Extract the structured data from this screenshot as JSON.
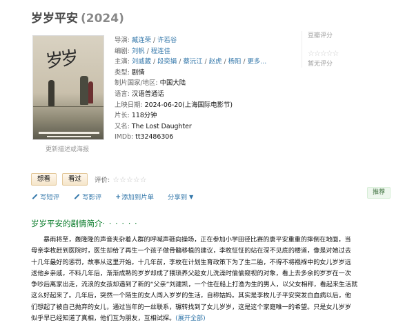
{
  "title": {
    "name": "岁岁平安",
    "year": "(2024)"
  },
  "poster": {
    "update_label": "更新描述或海报"
  },
  "info": {
    "director_label": "导演",
    "directors": [
      "臧连荣",
      "许若谷"
    ],
    "writer_label": "编剧",
    "writers": [
      "刘帆",
      "程连佳"
    ],
    "cast_label": "主演",
    "cast": [
      "刘威葳",
      "段奕娟",
      "蔡沅江",
      "赵虎",
      "杨阳"
    ],
    "cast_more": "更多...",
    "genre_label": "类型:",
    "genre": "剧情",
    "country_label": "制片国家/地区:",
    "country": "中国大陆",
    "language_label": "语言:",
    "language": "汉语普通话",
    "release_label": "上映日期:",
    "release": "2024-06-20(上海国际电影节)",
    "runtime_label": "片长:",
    "runtime": "118分钟",
    "aka_label": "又名:",
    "aka": "The Lost Daughter",
    "imdb_label": "IMDb:",
    "imdb": "tt32486306"
  },
  "rating": {
    "header": "豆瓣评分",
    "stars": "☆☆☆☆☆",
    "none_text": "暂无评分"
  },
  "actions": {
    "want": "想看",
    "watched": "看过",
    "rate_label": "评价:",
    "rate_stars": "☆☆☆☆☆"
  },
  "ops": {
    "write_short": "写短评",
    "write_review": "写影评",
    "add_list": "添加到片单",
    "share": "分享到",
    "recommend": "推荐"
  },
  "summary": {
    "title": "岁岁平安的剧情简介",
    "dots": "· · · · · ·",
    "lines": [
      "暴雨将至，轰隆隆的声音夹杂着人群的呼喊声砸向操场，正在参加小学田径比赛的唐平安重重的摔倒在地面，当",
      "母亲李枚赶到医院时，医生却给了再生一个孩子做骨髓移植的建议，李枚怔怔的站在深不见底的楼道，像是对她过去",
      "十几年最好的惩罚，故事从这里开始。十几年前，李枚在计划生育政策下为了生二胎，不得不将襁褓中的女儿岁岁远",
      "送他乡亲戚，不料几年后，渐渐成熟的岁岁却成了猥琐养父趁女儿洗澡时偷偷窥视的对象，看上去多余的岁岁在一次",
      "争吵后离家出走，流浪的女孩却遇到了新的“父亲”刘建凯，一个住在船上打渔为生的男人，以父女相称，看起来生活就",
      "这么好起来了。几年后，突然一个陌生的女人闯入岁岁的生活，自称姑妈。其实是李枚儿子平安突发白血病以后，他",
      "们想起了被自己抛弃的女儿，通过当年的一丝联系，辗转找到了女儿岁岁，这是这个家庭唯一的希望。只是女儿岁岁",
      "似乎早已经知道了真相，他们互为朋友，互相试探。"
    ],
    "expand": "(展开全部)"
  }
}
